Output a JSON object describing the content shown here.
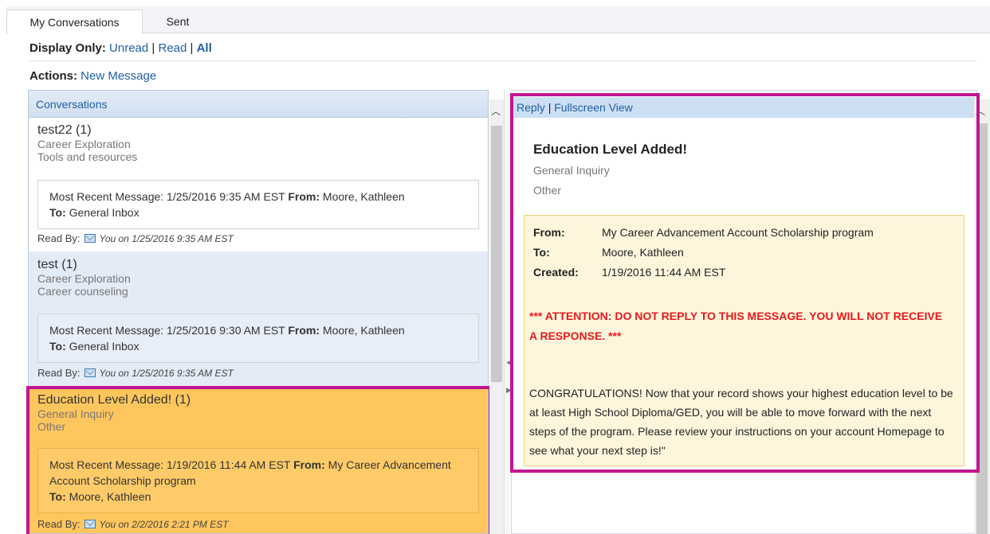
{
  "tabs": [
    {
      "label": "My Conversations",
      "active": true
    },
    {
      "label": "Sent",
      "active": false
    }
  ],
  "filter": {
    "label": "Display Only:",
    "options": [
      "Unread",
      "Read",
      "All"
    ],
    "selected": "All"
  },
  "actions": {
    "label": "Actions:",
    "new_message": "New Message"
  },
  "conversations": {
    "header": "Conversations",
    "items": [
      {
        "title": "test22 (1)",
        "category": "Career Exploration",
        "subcategory": "Tools and resources",
        "recent_prefix": "Most Recent Message: 1/25/2016 9:35 AM EST",
        "from_label": "From:",
        "from": "Moore, Kathleen",
        "to_label": "To:",
        "to": "General Inbox",
        "read_by_label": "Read By:",
        "read_by": "You on 1/25/2016 9:35 AM EST"
      },
      {
        "title": "test (1)",
        "category": "Career Exploration",
        "subcategory": "Career counseling",
        "recent_prefix": "Most Recent Message: 1/25/2016 9:30 AM EST",
        "from_label": "From:",
        "from": "Moore, Kathleen",
        "to_label": "To:",
        "to": "General Inbox",
        "read_by_label": "Read By:",
        "read_by": "You on 1/25/2016 9:35 AM EST"
      },
      {
        "title": "Education Level Added! (1)",
        "category": "General Inquiry",
        "subcategory": "Other",
        "recent_prefix": "Most Recent Message: 1/19/2016 11:44 AM EST",
        "from_label": "From:",
        "from": "My Career Advancement Account Scholarship program",
        "to_label": "To:",
        "to": "Moore, Kathleen",
        "read_by_label": "Read By:",
        "read_by": "You on 2/2/2016 2:21 PM EST"
      }
    ]
  },
  "message": {
    "reply": "Reply",
    "fullscreen": "Fullscreen View",
    "title": "Education Level Added!",
    "category": "General Inquiry",
    "subcategory": "Other",
    "from_label": "From:",
    "from": "My Career Advancement Account Scholarship program",
    "to_label": "To:",
    "to": "Moore, Kathleen",
    "created_label": "Created:",
    "created": "1/19/2016 11:44 AM EST",
    "attention": "*** ATTENTION: DO NOT REPLY TO THIS MESSAGE. YOU WILL NOT RECEIVE A RESPONSE. ***",
    "body": "CONGRATULATIONS! Now that your record shows your highest education level to be at least High School Diploma/GED, you will be able to move forward with the next steps of the program. Please review your instructions on your account Homepage to see what your next step is!\""
  },
  "colors": {
    "link": "#1f5fa6",
    "selected_item": "#ffc65d",
    "highlight_border": "#c21592",
    "attention": "#e8191b"
  }
}
